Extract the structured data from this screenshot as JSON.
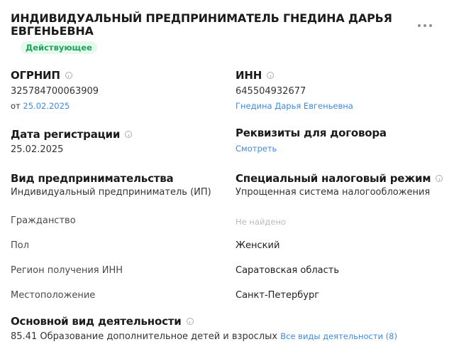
{
  "header": {
    "title": "ИНДИВИДУАЛЬНЫЙ ПРЕДПРИНИМАТЕЛЬ ГНЕДИНА ДАРЬЯ ЕВГЕНЬЕВНА",
    "status": "Действующее",
    "more_icon": "more-dots-icon"
  },
  "ogrnip": {
    "label": "ОГРНИП",
    "value": "325784700063909",
    "date_prefix": "от",
    "date": "25.02.2025"
  },
  "inn": {
    "label": "ИНН",
    "value": "645504932677",
    "owner_link": "Гнедина Дарья Евгеньевна"
  },
  "registration": {
    "label": "Дата регистрации",
    "value": "25.02.2025"
  },
  "requisites": {
    "label": "Реквизиты для договора",
    "link": "Смотреть"
  },
  "business_type": {
    "label": "Вид предпринимательства",
    "value": "Индивидуальный предприниматель (ИП)"
  },
  "tax_regime": {
    "label": "Специальный налоговый режим",
    "value": "Упрощенная система налогообложения"
  },
  "details": [
    {
      "label": "Гражданство",
      "value": "Не найдено"
    },
    {
      "label": "Пол",
      "value": "Женский"
    },
    {
      "label": "Регион получения ИНН",
      "value": "Саратовская область"
    },
    {
      "label": "Местоположение",
      "value": "Санкт-Петербург"
    }
  ],
  "activity": {
    "label": "Основной вид деятельности",
    "value": "85.41 Образование дополнительное детей и взрослых",
    "all_link": "Все виды деятельности (8)"
  },
  "colors": {
    "link": "#3f8ae0",
    "status_bg": "#e7f8ee",
    "status_text": "#1aa656"
  }
}
